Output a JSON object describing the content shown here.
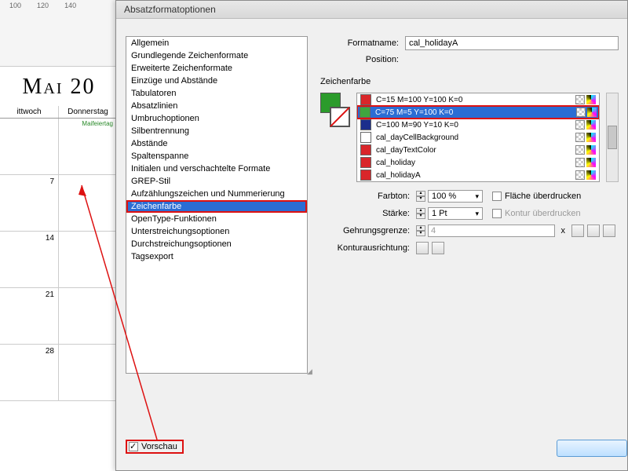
{
  "ruler": {
    "ticks": [
      "100",
      "120",
      "140"
    ]
  },
  "calendar": {
    "month": "Mai 20",
    "days": [
      "ittwoch",
      "Donnerstag"
    ],
    "holiday_label": "Maifeiertag",
    "nums": [
      "7",
      "14",
      "21",
      "28"
    ]
  },
  "dialog": {
    "title": "Absatzformatoptionen",
    "formatname_label": "Formatname:",
    "formatname_value": "cal_holidayA",
    "position_label": "Position:",
    "section_title": "Zeichenfarbe",
    "categories": [
      "Allgemein",
      "Grundlegende Zeichenformate",
      "Erweiterte Zeichenformate",
      "Einzüge und Abstände",
      "Tabulatoren",
      "Absatzlinien",
      "Umbruchoptionen",
      "Silbentrennung",
      "Abstände",
      "Spaltenspanne",
      "Initialen und verschachtelte Formate",
      "GREP-Stil",
      "Aufzählungszeichen und Nummerierung",
      "Zeichenfarbe",
      "OpenType-Funktionen",
      "Unterstreichungsoptionen",
      "Durchstreichungsoptionen",
      "Tagsexport"
    ],
    "selected_category_index": 13,
    "swatches": [
      {
        "name": "C=15 M=100 Y=100 K=0",
        "color": "#d9262a"
      },
      {
        "name": "C=75 M=5 Y=100 K=0",
        "color": "#3fa53f"
      },
      {
        "name": "C=100 M=90 Y=10 K=0",
        "color": "#1b2e8c"
      },
      {
        "name": "cal_dayCellBackground",
        "color": "#ffffff"
      },
      {
        "name": "cal_dayTextColor",
        "color": "#d9262a"
      },
      {
        "name": "cal_holiday",
        "color": "#d9262a"
      },
      {
        "name": "cal_holidayA",
        "color": "#d9262a"
      }
    ],
    "selected_swatch_index": 1,
    "farbton_label": "Farbton:",
    "farbton_value": "100 %",
    "flaeche_label": "Fläche überdrucken",
    "staerke_label": "Stärke:",
    "staerke_value": "1 Pt",
    "kontur_label": "Kontur überdrucken",
    "gehrung_label": "Gehrungsgrenze:",
    "gehrung_value": "4",
    "gehrung_x": "x",
    "konturaus_label": "Konturausrichtung:",
    "preview_label": "Vorschau"
  }
}
